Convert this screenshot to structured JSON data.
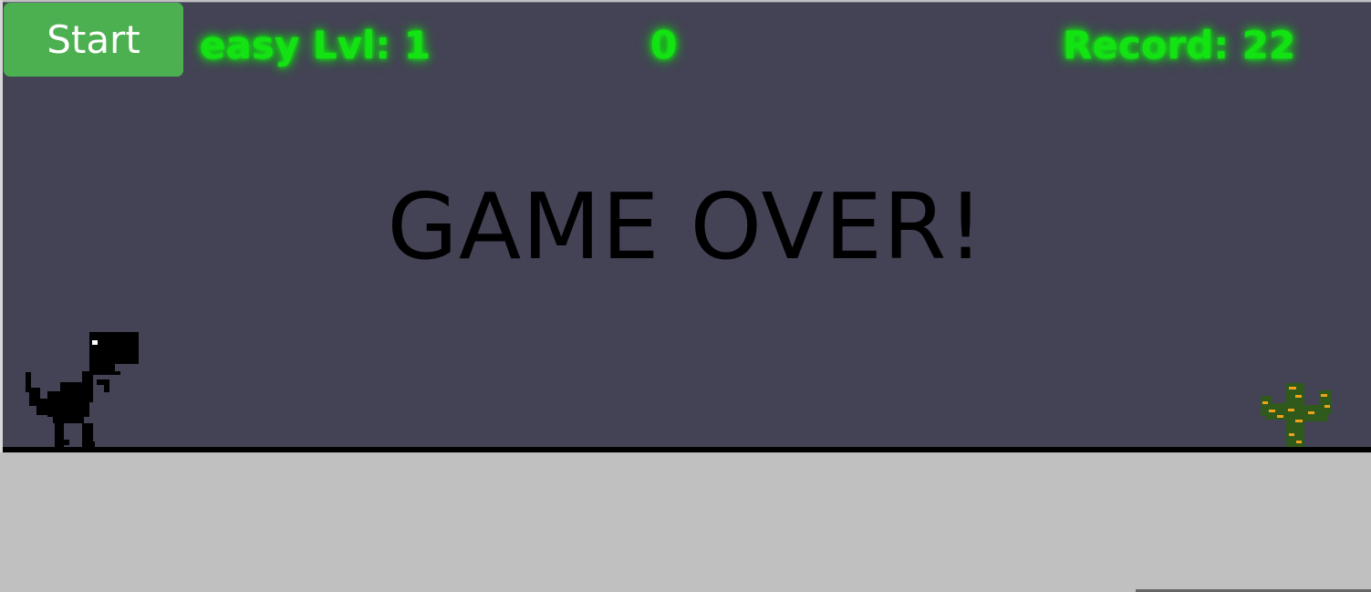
{
  "controls": {
    "start_label": "Start"
  },
  "hud": {
    "level": "easy Lvl: 1",
    "score": "0",
    "record": "Record: 22",
    "accent_color": "#13e313"
  },
  "status": {
    "message": "GAME OVER!"
  },
  "colors": {
    "sky": "#444255",
    "ground": "#c0c0c0",
    "button": "#4caf50",
    "dino": "#000000",
    "cactus": "#2f5a1c",
    "cactus_spots": "#f2a21a"
  },
  "sprites": {
    "player": "t-rex-dino-icon",
    "obstacle": "cactus-icon"
  }
}
